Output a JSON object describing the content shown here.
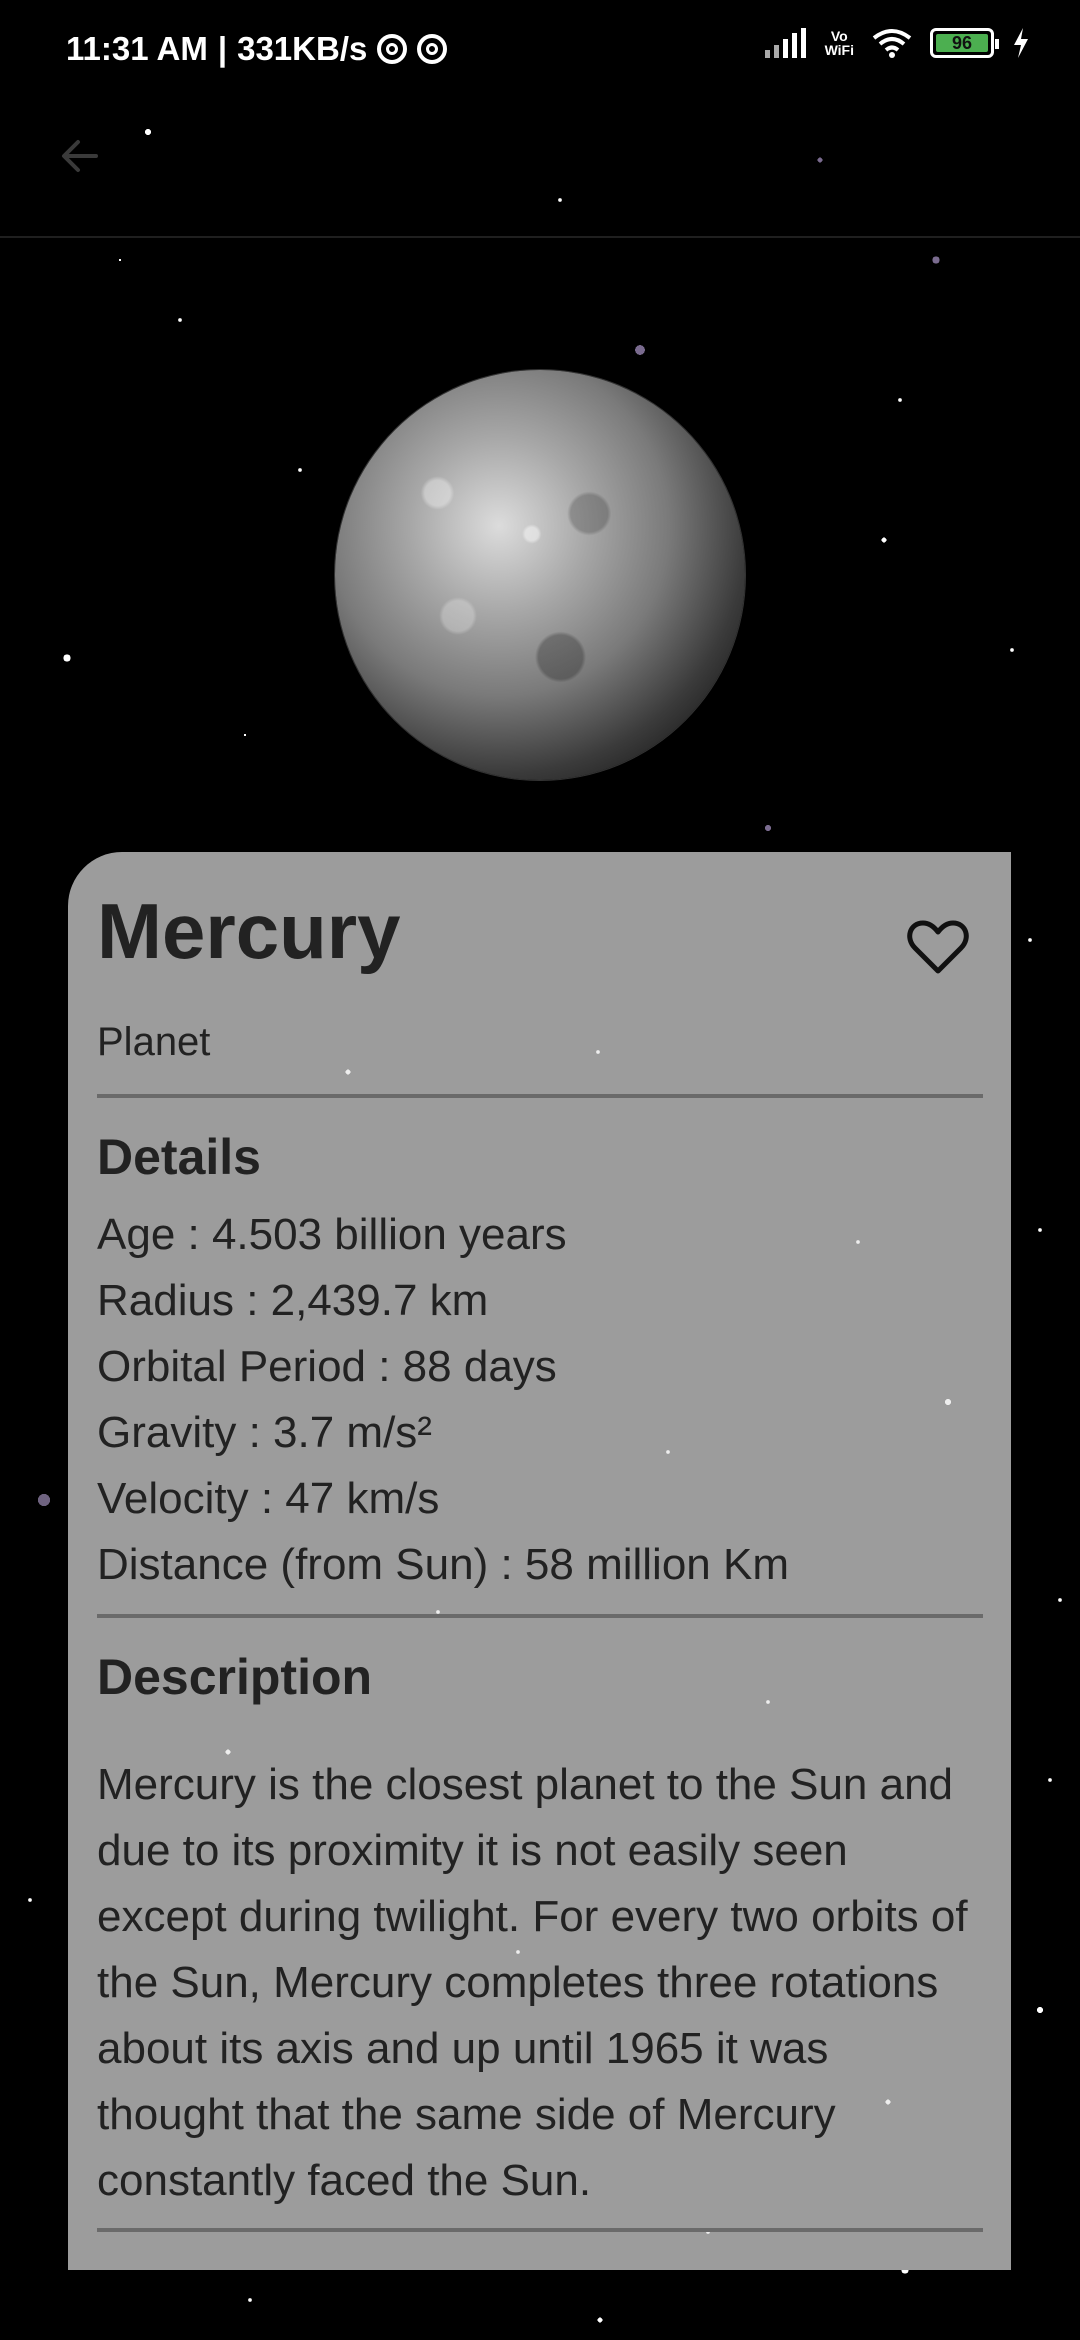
{
  "status_bar": {
    "time": "11:31 AM",
    "network_speed": "331KB/s",
    "vowifi_top": "Vo",
    "vowifi_bottom": "WiFi",
    "battery": "96"
  },
  "colors": {
    "background": "#000000",
    "card": "#9c9c9c",
    "text": "#222222",
    "battery": "#4caf50"
  },
  "icons": {
    "back": "arrow-left-icon",
    "favorite": "heart-outline-icon"
  },
  "planet": {
    "name": "Mercury",
    "type": "Planet"
  },
  "details": {
    "heading": "Details",
    "items": [
      "Age : 4.503 billion years",
      "Radius : 2,439.7 km",
      "Orbital Period : 88 days",
      "Gravity : 3.7 m/s²",
      "Velocity : 47 km/s",
      "Distance (from Sun) : 58 million Km"
    ]
  },
  "description": {
    "heading": "Description",
    "text": "Mercury is the closest planet to the Sun and due to its proximity it is not easily seen except during twilight. For every two orbits of the Sun, Mercury completes three rotations about its axis and up until 1965 it was thought that the same side of Mercury constantly faced the Sun."
  }
}
